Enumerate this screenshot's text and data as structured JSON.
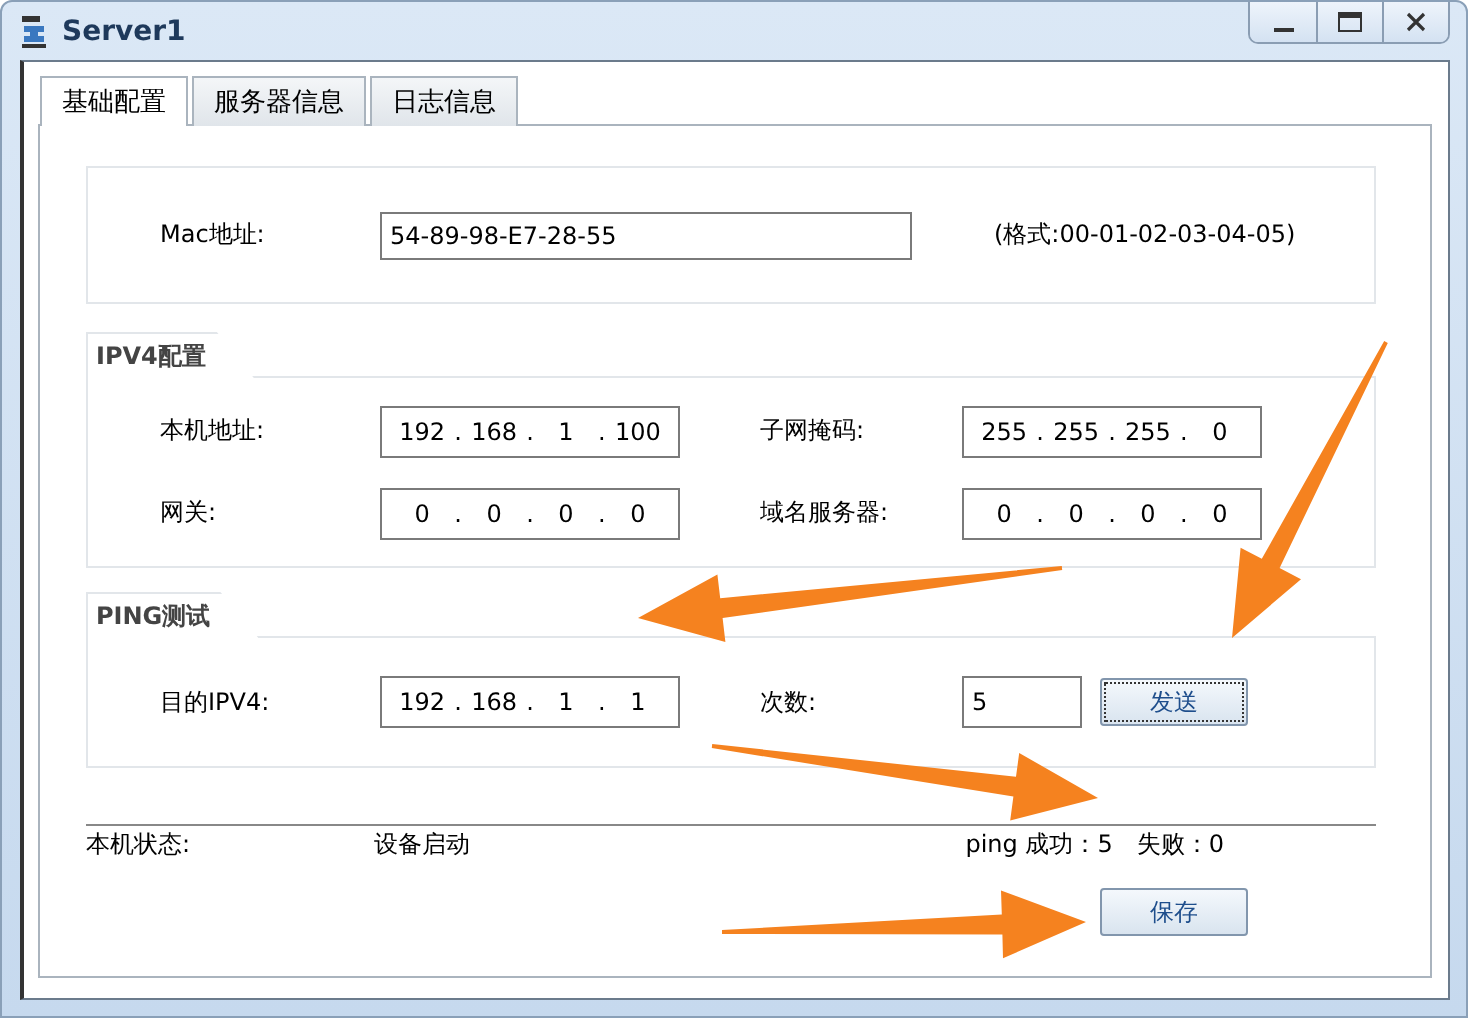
{
  "window": {
    "title": "Server1"
  },
  "tabs": [
    {
      "label": "基础配置",
      "selected": true
    },
    {
      "label": "服务器信息",
      "selected": false
    },
    {
      "label": "日志信息",
      "selected": false
    }
  ],
  "ip_separator": ".",
  "mac": {
    "label": "Mac地址:",
    "value": "54-89-98-E7-28-55",
    "hint": "(格式:00-01-02-03-04-05)"
  },
  "ipv4": {
    "title": "IPV4配置",
    "fields": [
      {
        "label": "本机地址:",
        "octets": [
          "192",
          "168",
          "1",
          "100"
        ]
      },
      {
        "label": "子网掩码:",
        "octets": [
          "255",
          "255",
          "255",
          "0"
        ]
      },
      {
        "label": "网关:",
        "octets": [
          "0",
          "0",
          "0",
          "0"
        ]
      },
      {
        "label": "域名服务器:",
        "octets": [
          "0",
          "0",
          "0",
          "0"
        ]
      }
    ]
  },
  "ping": {
    "title": "PING测试",
    "target": {
      "label": "目的IPV4:",
      "octets": [
        "192",
        "168",
        "1",
        "1"
      ]
    },
    "count": {
      "label": "次数:",
      "value": "5"
    },
    "send_button": "发送"
  },
  "status": {
    "label": "本机状态:",
    "value": "设备启动",
    "success": "ping 成功：5",
    "failure": "失败：0"
  },
  "save_button": "保存"
}
